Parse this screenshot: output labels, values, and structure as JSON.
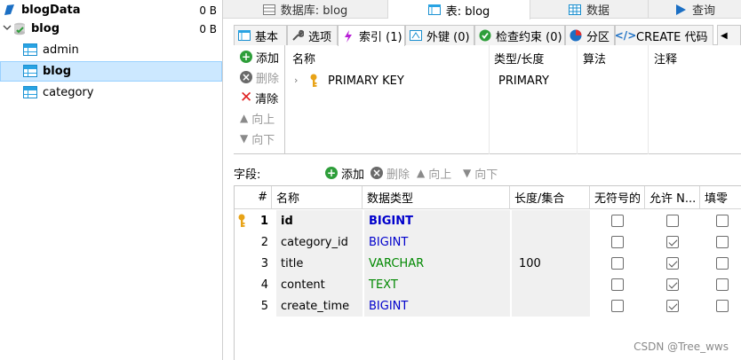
{
  "tree": {
    "items": [
      {
        "label": "blogData",
        "size": "0 B"
      },
      {
        "label": "blog",
        "size": "0 B"
      },
      {
        "label": "admin"
      },
      {
        "label": "blog"
      },
      {
        "label": "category"
      }
    ]
  },
  "top_tabs": [
    "数据库: blog",
    "表: blog",
    "数据",
    "查询"
  ],
  "sub_tabs": [
    "基本",
    "选项",
    "索引 (1)",
    "外键 (0)",
    "检查约束 (0)",
    "分区",
    "CREATE 代码"
  ],
  "index_tools": {
    "add": "添加",
    "delete": "删除",
    "clear": "清除",
    "up": "向上",
    "down": "向下"
  },
  "index_grid": {
    "headers": [
      "名称",
      "类型/长度",
      "算法",
      "注释"
    ],
    "rows": [
      {
        "name": "PRIMARY KEY",
        "type": "PRIMARY"
      }
    ]
  },
  "fields_toolbar": {
    "label": "字段:",
    "add": "添加",
    "delete": "删除",
    "up": "向上",
    "down": "向下"
  },
  "fields_grid": {
    "headers": [
      "#",
      "名称",
      "数据类型",
      "长度/集合",
      "无符号的",
      "允许 N...",
      "填零"
    ],
    "rows": [
      {
        "num": "1",
        "name": "id",
        "type": "BIGINT",
        "length": "",
        "unsigned": false,
        "nullable": false,
        "zerofill": false,
        "pk": true
      },
      {
        "num": "2",
        "name": "category_id",
        "type": "BIGINT",
        "length": "",
        "unsigned": false,
        "nullable": true,
        "zerofill": false,
        "pk": false
      },
      {
        "num": "3",
        "name": "title",
        "type": "VARCHAR",
        "length": "100",
        "unsigned": false,
        "nullable": true,
        "zerofill": false,
        "pk": false
      },
      {
        "num": "4",
        "name": "content",
        "type": "TEXT",
        "length": "",
        "unsigned": false,
        "nullable": true,
        "zerofill": false,
        "pk": false
      },
      {
        "num": "5",
        "name": "create_time",
        "type": "BIGINT",
        "length": "",
        "unsigned": false,
        "nullable": true,
        "zerofill": false,
        "pk": false
      }
    ]
  },
  "watermark": "CSDN @Tree_wws",
  "colors": {
    "selection": "#cce8ff",
    "type_int": "#0000cc",
    "type_text": "#008800",
    "key": "#e8a317",
    "add": "#2e9e3a",
    "delete": "#e02020"
  }
}
